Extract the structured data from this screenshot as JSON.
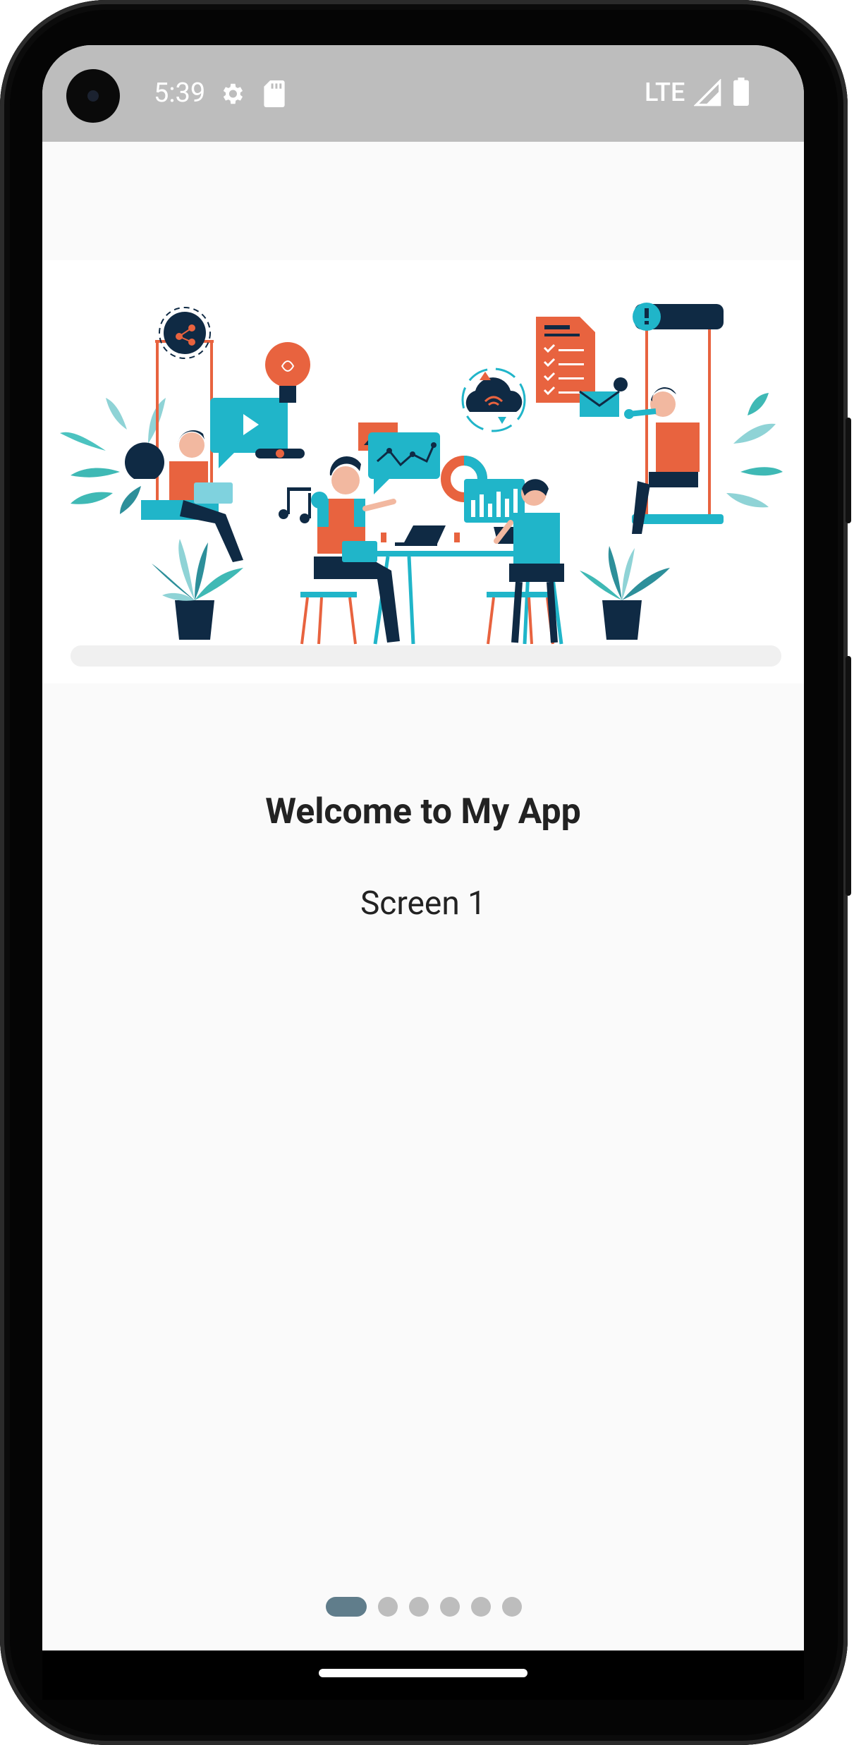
{
  "status_bar": {
    "time": "5:39",
    "icons": [
      "settings-gear-icon",
      "sd-card-icon"
    ],
    "network": "LTE",
    "right_icons": [
      "signal-icon",
      "battery-icon"
    ]
  },
  "onboarding": {
    "title": "Welcome to My App",
    "subtitle": "Screen 1",
    "page_count": 6,
    "current_page": 1
  },
  "colors": {
    "status_bar": "#bdbdbd",
    "background": "#fafafa",
    "indicator_active": "#607d8b",
    "indicator_inactive": "#bdbdbd",
    "accent_orange": "#e8633f",
    "accent_teal": "#20b5c9",
    "navy": "#0f2a44"
  }
}
